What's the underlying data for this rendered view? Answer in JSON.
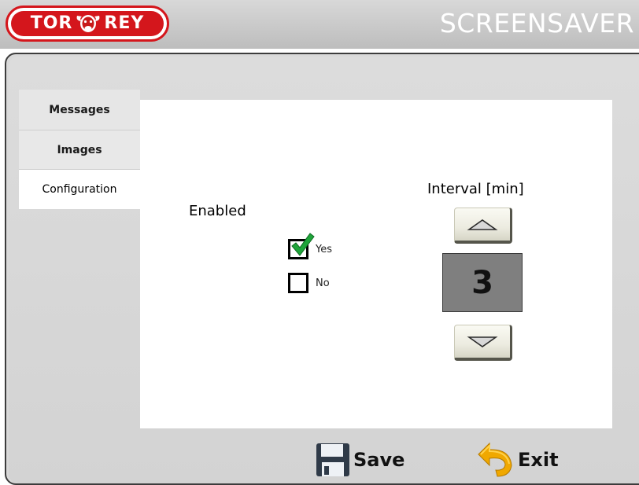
{
  "header": {
    "logo_text_left": "TOR",
    "logo_text_right": "REY",
    "title": "SCREENSAVER",
    "brand_color": "#d4161c"
  },
  "sidebar": {
    "items": [
      {
        "label": "Messages",
        "active": false
      },
      {
        "label": "Images",
        "active": false
      },
      {
        "label": "Configuration",
        "active": true
      }
    ]
  },
  "config": {
    "enabled_label": "Enabled",
    "options": [
      {
        "label": "Yes",
        "checked": true
      },
      {
        "label": "No",
        "checked": false
      }
    ],
    "interval_label": "Interval [min]",
    "interval_value": "3",
    "up_icon": "arrow-up-icon",
    "down_icon": "arrow-down-icon"
  },
  "footer": {
    "save_label": "Save",
    "exit_label": "Exit",
    "save_icon": "floppy-disk-icon",
    "exit_icon": "back-arrow-icon"
  }
}
